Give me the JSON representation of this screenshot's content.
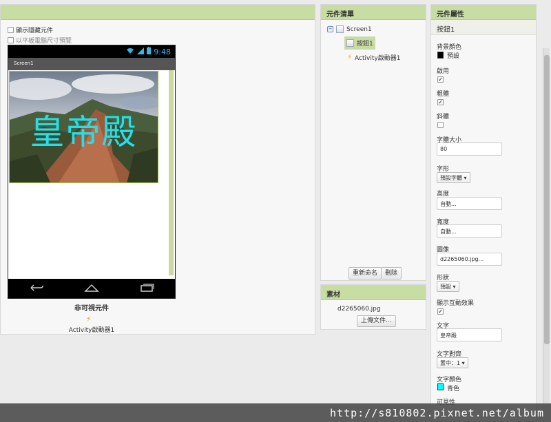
{
  "viewer": {
    "show_hidden_label": "顯示隱藏元件",
    "tablet_preview_label": "以平板電腦尺寸預覽",
    "status_time": "9:48",
    "screen_title": "Screen1",
    "button_text": "皇帝殿",
    "nonvisible_title": "非可視元件",
    "nonvisible_item": "Activity啟動器1"
  },
  "tree": {
    "header": "元件清單",
    "items": [
      {
        "label": "Screen1"
      },
      {
        "label": "按鈕1"
      },
      {
        "label": "Activity啟動器1"
      }
    ],
    "rename_button": "重新命名",
    "delete_button": "刪除"
  },
  "media": {
    "header": "素材",
    "file": "d2265060.jpg",
    "upload_button": "上傳文件..."
  },
  "props": {
    "header": "元件屬性",
    "component": "按鈕1",
    "background_color_label": "背景顏色",
    "background_color_value": "預設",
    "enabled_label": "啟用",
    "bold_label": "粗體",
    "italic_label": "斜體",
    "font_size_label": "字體大小",
    "font_size_value": "80",
    "font_typeface_label": "字形",
    "font_typeface_value": "預設字體 ▾",
    "height_label": "高度",
    "height_value": "自動...",
    "width_label": "寬度",
    "width_value": "自動...",
    "image_label": "圖像",
    "image_value": "d2265060.jpg...",
    "shape_label": "形狀",
    "shape_value": "預設 ▾",
    "show_feedback_label": "顯示互動效果",
    "text_label": "文字",
    "text_value": "皇帝殿",
    "text_alignment_label": "文字對齊",
    "text_alignment_value": "置中：1 ▾",
    "text_color_label": "文字顏色",
    "text_color_value": "青色",
    "visible_label": "可見性"
  },
  "colors": {
    "header_green": "#c8dda4",
    "text_color_swatch": "#00ffff",
    "background_swatch": "#000000"
  },
  "watermark": "http://s810802.pixnet.net/album"
}
